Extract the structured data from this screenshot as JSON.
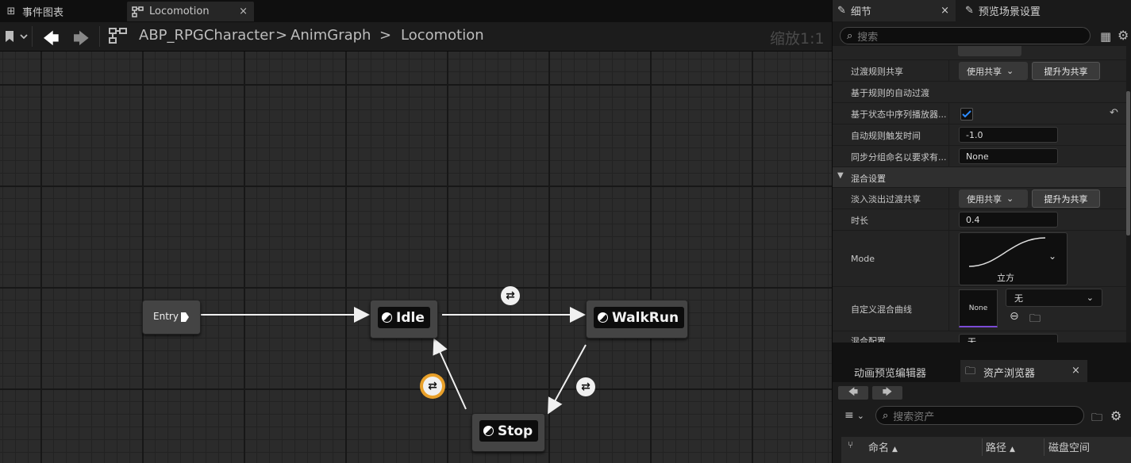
{
  "tabs": [
    {
      "label": "事件图表",
      "icon": "event-graph-icon"
    },
    {
      "label": "Locomotion",
      "icon": "state-machine-icon",
      "close": "×"
    }
  ],
  "toolbar": {
    "back": "🡄",
    "forward": "🡆",
    "breadcrumb": [
      "ABP_RPGCharacter",
      "AnimGraph",
      "Locomotion"
    ],
    "separator": ">",
    "zoom": "缩放1:1"
  },
  "graph": {
    "entry": "Entry",
    "states": [
      {
        "name": "Idle"
      },
      {
        "name": "WalkRun"
      },
      {
        "name": "Stop"
      }
    ]
  },
  "details": {
    "tab_details": "细节",
    "tab_preview": "预览场景设置",
    "close": "×",
    "search_placeholder": "搜索",
    "rows": {
      "transition_rule_share": "过渡规则共享",
      "use_shared": "使用共享",
      "promote_shared": "提升为共享",
      "auto_rule": "基于规则的自动过渡",
      "auto_rule_seq": "基于状态中序列播放器...",
      "auto_trigger_time": "自动规则触发时间",
      "auto_trigger_value": "-1.0",
      "sync_group": "同步分组命名以要求有...",
      "sync_group_value": "None",
      "blend_section": "混合设置",
      "crossfade_share": "淡入淡出过渡共享",
      "duration": "时长",
      "duration_value": "0.4",
      "mode": "Mode",
      "mode_value": "立方",
      "custom_curve": "自定义混合曲线",
      "curve_none": "None",
      "curve_combo": "无",
      "blend_profile": "混合配置",
      "blend_profile_value": "无"
    }
  },
  "bottom": {
    "tab_anim_preview": "动画预览编辑器",
    "tab_asset_browser": "资产浏览器",
    "search_placeholder": "搜索资产",
    "columns": [
      "命名",
      "路径",
      "磁盘空间"
    ]
  },
  "colors": {
    "accent": "#0f6cd6",
    "highlight_transition": "#e8a02a"
  }
}
